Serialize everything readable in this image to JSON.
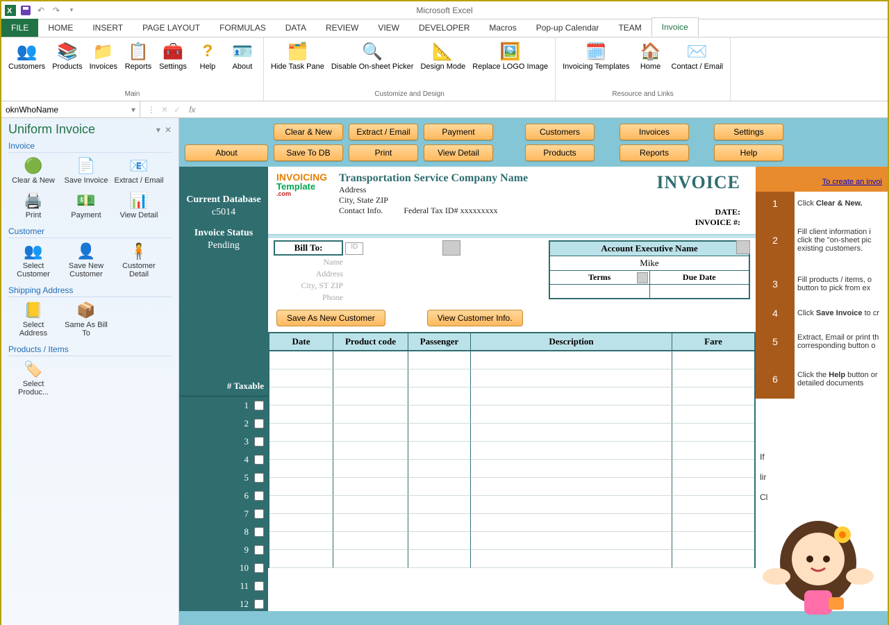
{
  "app": {
    "title": "Microsoft Excel"
  },
  "ribbon_tabs": [
    "FILE",
    "HOME",
    "INSERT",
    "PAGE LAYOUT",
    "FORMULAS",
    "DATA",
    "REVIEW",
    "VIEW",
    "DEVELOPER",
    "Macros",
    "Pop-up Calendar",
    "TEAM",
    "Invoice"
  ],
  "ribbon_active": "Invoice",
  "ribbon_groups": {
    "main": {
      "label": "Main",
      "items": [
        "Customers",
        "Products",
        "Invoices",
        "Reports",
        "Settings",
        "Help",
        "About"
      ]
    },
    "customize": {
      "label": "Customize and Design",
      "items": [
        "Hide Task Pane",
        "Disable On-sheet Picker",
        "Design Mode",
        "Replace LOGO Image"
      ]
    },
    "resource": {
      "label": "Resource and Links",
      "items": [
        "Invoicing Templates",
        "Home",
        "Contact / Email"
      ]
    }
  },
  "name_box": "oknWhoName",
  "task_pane": {
    "title": "Uniform Invoice",
    "sections": {
      "invoice": {
        "label": "Invoice",
        "items": [
          "Clear & New",
          "Save Invoice",
          "Extract / Email",
          "Print",
          "Payment",
          "View Detail"
        ]
      },
      "customer": {
        "label": "Customer",
        "items": [
          "Select Customer",
          "Save New Customer",
          "Customer Detail"
        ]
      },
      "shipping": {
        "label": "Shipping Address",
        "items": [
          "Select Address",
          "Same As Bill To"
        ]
      },
      "products": {
        "label": "Products / Items",
        "items": [
          "Select Produc..."
        ]
      }
    }
  },
  "actions": {
    "row1": [
      "",
      "Clear & New",
      "Extract / Email",
      "Payment",
      "",
      "Customers",
      "",
      "Invoices",
      "",
      "Settings"
    ],
    "row2": [
      "About",
      "Save To DB",
      "Print",
      "View Detail",
      "",
      "Products",
      "",
      "Reports",
      "",
      "Help"
    ]
  },
  "database": {
    "label": "Current Database",
    "value": "c5014",
    "status_label": "Invoice Status",
    "status": "Pending"
  },
  "company": {
    "name": "Transportation Service Company Name",
    "address": "Address",
    "csz": "City, State ZIP",
    "contact": "Contact Info.",
    "taxid": "Federal Tax ID# xxxxxxxxx"
  },
  "invoice_title": "INVOICE",
  "labels": {
    "date": "DATE:",
    "invoice_no": "INVOICE #:"
  },
  "billto": {
    "header": "Bill To:",
    "id_placeholder": "ID",
    "fields": [
      "Name",
      "Address",
      "City, ST ZIP",
      "Phone"
    ]
  },
  "account": {
    "header": "Account Executive Name",
    "value": "Mike",
    "terms": "Terms",
    "due": "Due Date"
  },
  "sub_buttons": [
    "Save As New Customer",
    "View Customer Info."
  ],
  "grid": {
    "left_header": "# Taxable",
    "rows": 12,
    "cols": [
      "Date",
      "Product code",
      "Passenger",
      "Description",
      "Fare"
    ]
  },
  "help": {
    "link": "To create an invoi",
    "steps": [
      "Click <b>Clear & New.</b>",
      "Fill client information i<br>click the \"on-sheet pic<br>existing customers.",
      "Fill products / items, o<br>button to pick from ex",
      "Click <b>Save Invoice</b> to cr",
      "Extract, Email or print th<br>corresponding button o",
      "Click the <b>Help</b> button or<br>detailed documents"
    ],
    "notes": [
      "If",
      "lir",
      "Cl"
    ]
  }
}
